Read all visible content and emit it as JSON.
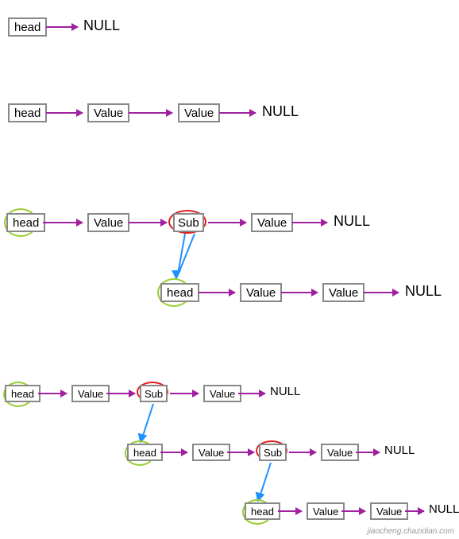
{
  "labels": {
    "head": "head",
    "value": "Value",
    "sub": "Sub",
    "null": "NULL"
  },
  "diagrams": [
    {
      "id": 1,
      "description": "single head pointing to NULL",
      "nodes": [
        "head"
      ],
      "terminal": "NULL"
    },
    {
      "id": 2,
      "description": "head -> Value -> Value -> NULL",
      "nodes": [
        "head",
        "Value",
        "Value"
      ],
      "terminal": "NULL"
    },
    {
      "id": 3,
      "description": "head -> Value -> Sub -> Value -> NULL with sub-list head -> Value -> Value -> NULL",
      "main": [
        "head",
        "Value",
        "Sub",
        "Value"
      ],
      "main_terminal": "NULL",
      "sublist": [
        "head",
        "Value",
        "Value"
      ],
      "sublist_terminal": "NULL",
      "highlighted_head": true,
      "sub_node_highlighted": true,
      "sub_head_highlighted": true
    },
    {
      "id": 4,
      "description": "head -> Value -> Sub -> Value -> NULL; sub: head -> Value -> Sub -> Value -> NULL; sub-sub: head -> Value -> Value -> NULL",
      "level1": [
        "head",
        "Value",
        "Sub",
        "Value"
      ],
      "level1_terminal": "NULL",
      "level2": [
        "head",
        "Value",
        "Sub",
        "Value"
      ],
      "level2_terminal": "NULL",
      "level3": [
        "head",
        "Value",
        "Value"
      ],
      "level3_terminal": "NULL",
      "highlighted_heads": [
        1,
        2,
        3
      ],
      "highlighted_subs": [
        1,
        2
      ]
    }
  ],
  "colors": {
    "box_border": "#888888",
    "arrow": "#a020a0",
    "head_circle": "#9ACD32",
    "sub_circle": "#e02020",
    "sub_arrow": "#1E90FF"
  },
  "watermark": "jiaocheng.chazidian.com"
}
